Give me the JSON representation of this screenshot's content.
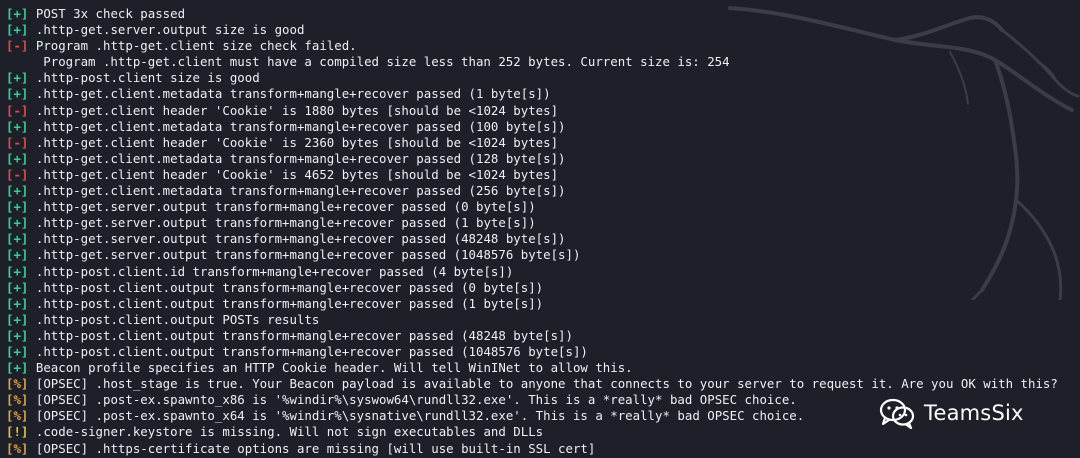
{
  "lines": [
    {
      "prefix": "[+]",
      "type": "plus",
      "text": "POST 3x check passed"
    },
    {
      "prefix": "[+]",
      "type": "plus",
      "text": ".http-get.server.output size is good"
    },
    {
      "prefix": "[-]",
      "type": "minus",
      "text": "Program .http-get.client size check failed."
    },
    {
      "prefix": "",
      "type": "none",
      "text": "     Program .http-get.client must have a compiled size less than 252 bytes. Current size is: 254"
    },
    {
      "prefix": "[+]",
      "type": "plus",
      "text": ".http-post.client size is good"
    },
    {
      "prefix": "[+]",
      "type": "plus",
      "text": ".http-get.client.metadata transform+mangle+recover passed (1 byte[s])"
    },
    {
      "prefix": "[-]",
      "type": "minus",
      "text": ".http-get.client header 'Cookie' is 1880 bytes [should be <1024 bytes]"
    },
    {
      "prefix": "[+]",
      "type": "plus",
      "text": ".http-get.client.metadata transform+mangle+recover passed (100 byte[s])"
    },
    {
      "prefix": "[-]",
      "type": "minus",
      "text": ".http-get.client header 'Cookie' is 2360 bytes [should be <1024 bytes]"
    },
    {
      "prefix": "[+]",
      "type": "plus",
      "text": ".http-get.client.metadata transform+mangle+recover passed (128 byte[s])"
    },
    {
      "prefix": "[-]",
      "type": "minus",
      "text": ".http-get.client header 'Cookie' is 4652 bytes [should be <1024 bytes]"
    },
    {
      "prefix": "[+]",
      "type": "plus",
      "text": ".http-get.client.metadata transform+mangle+recover passed (256 byte[s])"
    },
    {
      "prefix": "[+]",
      "type": "plus",
      "text": ".http-get.server.output transform+mangle+recover passed (0 byte[s])"
    },
    {
      "prefix": "[+]",
      "type": "plus",
      "text": ".http-get.server.output transform+mangle+recover passed (1 byte[s])"
    },
    {
      "prefix": "[+]",
      "type": "plus",
      "text": ".http-get.server.output transform+mangle+recover passed (48248 byte[s])"
    },
    {
      "prefix": "[+]",
      "type": "plus",
      "text": ".http-get.server.output transform+mangle+recover passed (1048576 byte[s])"
    },
    {
      "prefix": "[+]",
      "type": "plus",
      "text": ".http-post.client.id transform+mangle+recover passed (4 byte[s])"
    },
    {
      "prefix": "[+]",
      "type": "plus",
      "text": ".http-post.client.output transform+mangle+recover passed (0 byte[s])"
    },
    {
      "prefix": "[+]",
      "type": "plus",
      "text": ".http-post.client.output transform+mangle+recover passed (1 byte[s])"
    },
    {
      "prefix": "[+]",
      "type": "plus",
      "text": ".http-post.client.output POSTs results"
    },
    {
      "prefix": "[+]",
      "type": "plus",
      "text": ".http-post.client.output transform+mangle+recover passed (48248 byte[s])"
    },
    {
      "prefix": "[+]",
      "type": "plus",
      "text": ".http-post.client.output transform+mangle+recover passed (1048576 byte[s])"
    },
    {
      "prefix": "[+]",
      "type": "plus",
      "text": "Beacon profile specifies an HTTP Cookie header. Will tell WinINet to allow this."
    },
    {
      "prefix": "[%]",
      "type": "pct",
      "text": "[OPSEC] .host_stage is true. Your Beacon payload is available to anyone that connects to your server to request it. Are you OK with this?"
    },
    {
      "prefix": "[%]",
      "type": "pct",
      "text": "[OPSEC] .post-ex.spawnto_x86 is '%windir%\\syswow64\\rundll32.exe'. This is a *really* bad OPSEC choice."
    },
    {
      "prefix": "[%]",
      "type": "pct",
      "text": "[OPSEC] .post-ex.spawnto_x64 is '%windir%\\sysnative\\rundll32.exe'. This is a *really* bad OPSEC choice."
    },
    {
      "prefix": "[!]",
      "type": "bang",
      "text": ".code-signer.keystore is missing. Will not sign executables and DLLs"
    },
    {
      "prefix": "[%]",
      "type": "pct",
      "text": "[OPSEC] .https-certificate options are missing [will use built-in SSL cert]"
    }
  ],
  "watermark": {
    "text": "TeamsSix",
    "icon": "wechat-icon"
  },
  "background_icon": "kali-dragon-icon",
  "colors": {
    "background": "#1e2029",
    "plus": "#36cf9a",
    "minus": "#e04a4a",
    "percent": "#d9a441",
    "bang": "#e2c244",
    "text": "#eceff4"
  }
}
